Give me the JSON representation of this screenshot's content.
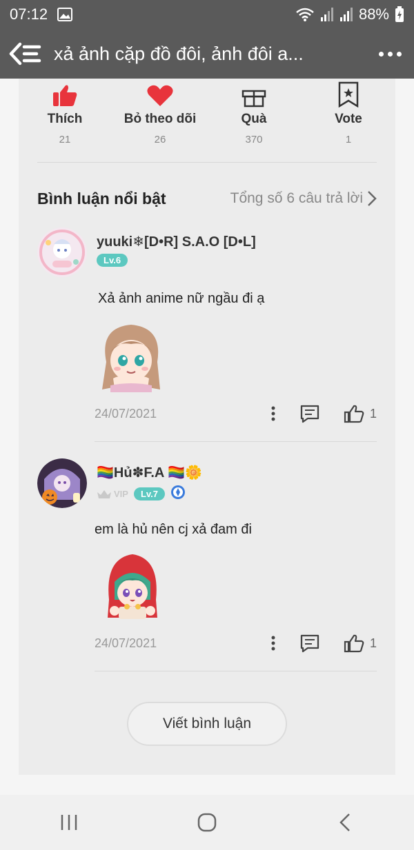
{
  "status_bar": {
    "time": "07:12",
    "battery": "88%"
  },
  "top_bar": {
    "title": "xả ảnh cặp đồ đôi, ảnh đôi a..."
  },
  "actions": [
    {
      "label": "Thích",
      "count": "21",
      "icon": "thumbs-up-icon"
    },
    {
      "label": "Bỏ theo dõi",
      "count": "26",
      "icon": "heart-icon"
    },
    {
      "label": "Quà",
      "count": "370",
      "icon": "gift-icon"
    },
    {
      "label": "Vote",
      "count": "1",
      "icon": "vote-ribbon-icon"
    }
  ],
  "section": {
    "title": "Bình luận nổi bật",
    "total": "Tổng số 6 câu trả lời"
  },
  "comments": [
    {
      "username": "yuuki❄[D•R] S.A.O [D•L]",
      "level": "Lv.6",
      "text": "Xả ảnh anime nữ ngầu đi ạ",
      "date": "24/07/2021",
      "likes": "1"
    },
    {
      "username": "🏳️‍🌈Hủ✽F.A 🏳️‍🌈🌼",
      "vip": "VIP",
      "level": "Lv.7",
      "text": "em là hủ nên cj xả đam đi",
      "date": "24/07/2021",
      "likes": "1"
    }
  ],
  "write_button": "Viết bình luận",
  "colors": {
    "header_bg": "#5a5a5a",
    "accent_red": "#e8343c",
    "level_badge": "#5cc8c0"
  }
}
